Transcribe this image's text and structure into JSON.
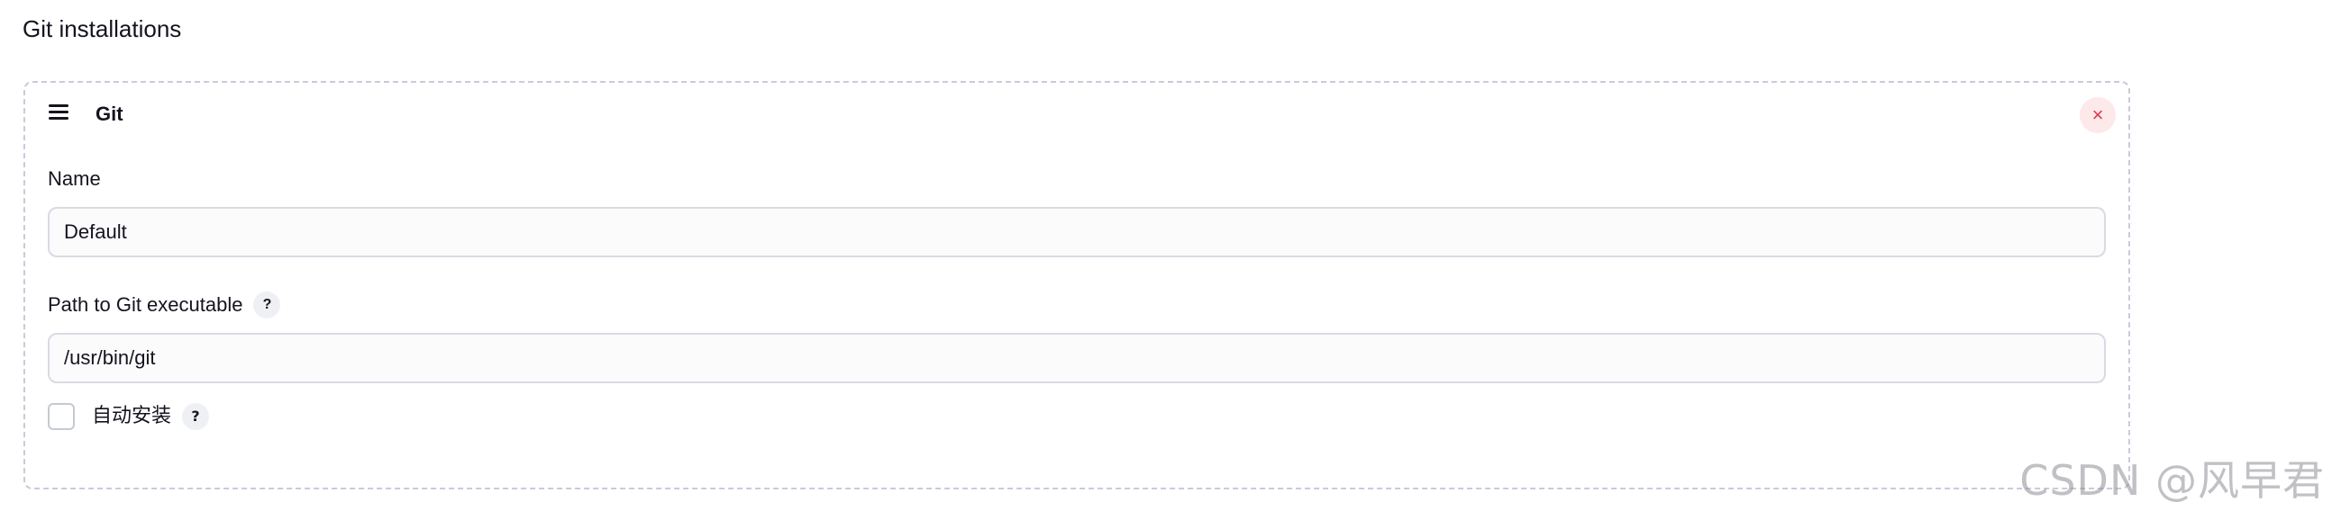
{
  "section": {
    "title": "Git installations"
  },
  "card": {
    "title": "Git",
    "delete_label": "×",
    "drag_icon": "hamburger-icon"
  },
  "fields": {
    "name": {
      "label": "Name",
      "value": "Default"
    },
    "path": {
      "label": "Path to Git executable",
      "help": "?",
      "value": "/usr/bin/git"
    },
    "auto_install": {
      "label": "自动安装",
      "help": "?",
      "checked": false
    }
  },
  "watermark": {
    "text": "CSDN @风早君"
  },
  "colors": {
    "delete_bg": "#fde8ea",
    "delete_fg": "#e0364a",
    "border": "#c8ccd8",
    "text": "#14141f"
  }
}
